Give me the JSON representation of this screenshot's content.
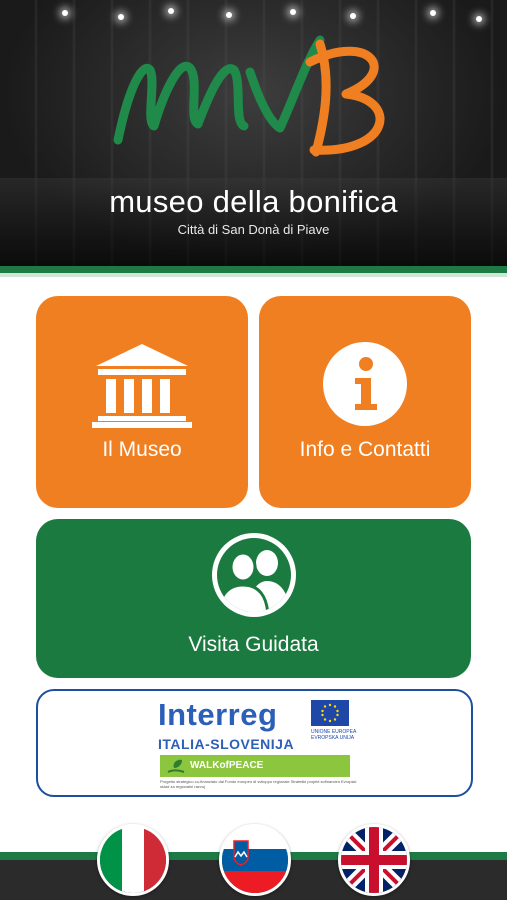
{
  "header": {
    "logo_text": "MVB",
    "title": "museo della bonifica",
    "subtitle": "Città di San Donà di Piave"
  },
  "tiles": {
    "museo": {
      "label": "Il Museo",
      "icon": "museum-building-icon"
    },
    "info": {
      "label": "Info e Contatti",
      "icon": "info-circle-icon"
    },
    "visita": {
      "label": "Visita Guidata",
      "icon": "people-icon"
    }
  },
  "partner": {
    "interreg": "Interreg",
    "region": "ITALIA-SLOVENIJA",
    "eu_label": "UNIONE EUROPEA EVROPSKA UNIJA",
    "project": "WALKofPEACE",
    "fine_print": "Progetto strategico co-finanziato dal Fondo europeo di sviluppo regionale Strateški projekt sofinancira Evropski sklad za regionalni razvoj"
  },
  "languages": [
    {
      "code": "it",
      "icon": "italy-flag-icon"
    },
    {
      "code": "si",
      "icon": "slovenia-flag-icon"
    },
    {
      "code": "en",
      "icon": "uk-flag-icon"
    }
  ],
  "colors": {
    "orange": "#f07f22",
    "green": "#1b7a3f",
    "interreg_blue": "#2c5fb8",
    "walk_green": "#8cc63f"
  }
}
